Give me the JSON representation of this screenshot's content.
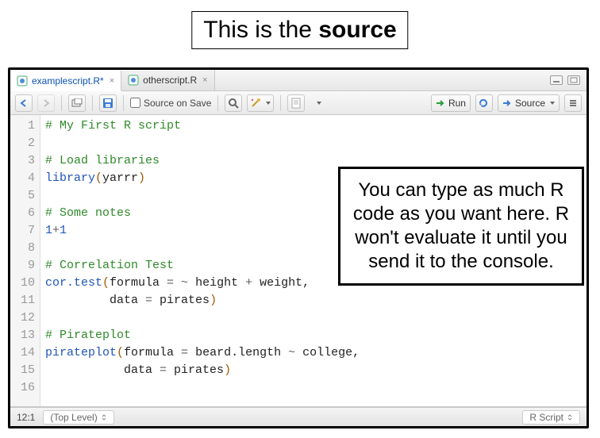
{
  "banner": {
    "prefix": "This is the ",
    "bold": "source"
  },
  "tabs": [
    {
      "label": "examplescript.R*",
      "active": true
    },
    {
      "label": "otherscript.R",
      "active": false
    }
  ],
  "toolbar": {
    "source_on_save": "Source on Save",
    "run": "Run",
    "source": "Source"
  },
  "code_lines": [
    {
      "n": 1,
      "segs": [
        {
          "t": "# My First R script",
          "c": "c-comment"
        }
      ]
    },
    {
      "n": 2,
      "segs": []
    },
    {
      "n": 3,
      "segs": [
        {
          "t": "# Load libraries",
          "c": "c-comment"
        }
      ]
    },
    {
      "n": 4,
      "segs": [
        {
          "t": "library",
          "c": "c-func"
        },
        {
          "t": "(",
          "c": "c-paren"
        },
        {
          "t": "yarrr",
          "c": "c-name"
        },
        {
          "t": ")",
          "c": "c-paren"
        }
      ]
    },
    {
      "n": 5,
      "segs": []
    },
    {
      "n": 6,
      "segs": [
        {
          "t": "# Some notes",
          "c": "c-comment"
        }
      ]
    },
    {
      "n": 7,
      "segs": [
        {
          "t": "1",
          "c": "c-num"
        },
        {
          "t": "+",
          "c": "c-op"
        },
        {
          "t": "1",
          "c": "c-num"
        }
      ]
    },
    {
      "n": 8,
      "segs": []
    },
    {
      "n": 9,
      "segs": [
        {
          "t": "# Correlation Test",
          "c": "c-comment"
        }
      ]
    },
    {
      "n": 10,
      "segs": [
        {
          "t": "cor.test",
          "c": "c-func"
        },
        {
          "t": "(",
          "c": "c-paren"
        },
        {
          "t": "formula ",
          "c": "c-name"
        },
        {
          "t": "= ~",
          "c": "c-op"
        },
        {
          "t": " height ",
          "c": "c-name"
        },
        {
          "t": "+",
          "c": "c-op"
        },
        {
          "t": " weight,",
          "c": "c-name"
        }
      ]
    },
    {
      "n": 11,
      "segs": [
        {
          "t": "         data ",
          "c": "c-name"
        },
        {
          "t": "=",
          "c": "c-op"
        },
        {
          "t": " pirates",
          "c": "c-name"
        },
        {
          "t": ")",
          "c": "c-paren"
        }
      ]
    },
    {
      "n": 12,
      "segs": []
    },
    {
      "n": 13,
      "segs": [
        {
          "t": "# Pirateplot",
          "c": "c-comment"
        }
      ]
    },
    {
      "n": 14,
      "segs": [
        {
          "t": "pirateplot",
          "c": "c-func"
        },
        {
          "t": "(",
          "c": "c-paren"
        },
        {
          "t": "formula ",
          "c": "c-name"
        },
        {
          "t": "=",
          "c": "c-op"
        },
        {
          "t": " beard.length ",
          "c": "c-name"
        },
        {
          "t": "~",
          "c": "c-op"
        },
        {
          "t": " college,",
          "c": "c-name"
        }
      ]
    },
    {
      "n": 15,
      "segs": [
        {
          "t": "           data ",
          "c": "c-name"
        },
        {
          "t": "=",
          "c": "c-op"
        },
        {
          "t": " pirates",
          "c": "c-name"
        },
        {
          "t": ")",
          "c": "c-paren"
        }
      ]
    },
    {
      "n": 16,
      "segs": []
    }
  ],
  "statusbar": {
    "cursor": "12:1",
    "scope": "(Top Level)",
    "filetype": "R Script"
  },
  "callout": "You can type as much R code as you want here. R won't evaluate it until you send it to the console."
}
